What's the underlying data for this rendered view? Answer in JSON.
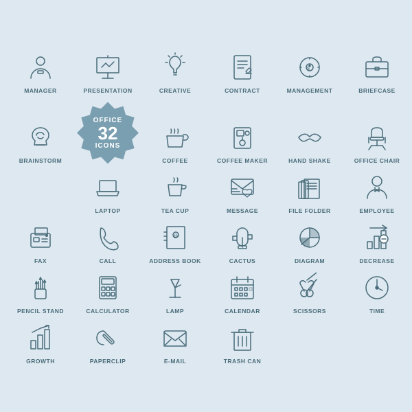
{
  "icons": [
    {
      "id": "manager",
      "label": "MANAGER"
    },
    {
      "id": "presentation",
      "label": "PRESENTATION"
    },
    {
      "id": "creative",
      "label": "CREATIVE"
    },
    {
      "id": "contract",
      "label": "CONTRACT"
    },
    {
      "id": "management",
      "label": "MANAGEMENT"
    },
    {
      "id": "briefcase",
      "label": "BRIEFCASE"
    },
    {
      "id": "brainstorm",
      "label": "BRAINSTORM"
    },
    {
      "id": "office-badge",
      "label": ""
    },
    {
      "id": "coffee",
      "label": "COFFEE"
    },
    {
      "id": "coffee-maker",
      "label": "COFFEE MAKER"
    },
    {
      "id": "handshake",
      "label": "HAND SHAKE"
    },
    {
      "id": "office-chair",
      "label": "OFFICE CHAIR"
    },
    {
      "id": "laptop",
      "label": "LAPTOP"
    },
    {
      "id": "tea-cup",
      "label": "TEA CUP"
    },
    {
      "id": "message",
      "label": "MESSAGE"
    },
    {
      "id": "file-folder",
      "label": "FILE FOLDER"
    },
    {
      "id": "employee",
      "label": "EMPLOYEE"
    },
    {
      "id": "fax",
      "label": "FAX"
    },
    {
      "id": "call",
      "label": "CALL"
    },
    {
      "id": "address-book",
      "label": "ADDRESS BOOK"
    },
    {
      "id": "cactus",
      "label": "CACTUS"
    },
    {
      "id": "diagram",
      "label": "DIAGRAM"
    },
    {
      "id": "decrease",
      "label": "DECREASE"
    },
    {
      "id": "pencil-stand",
      "label": "PENCIL STAND"
    },
    {
      "id": "calculator",
      "label": "CALCULATOR"
    },
    {
      "id": "lamp",
      "label": "LAMP"
    },
    {
      "id": "calendar",
      "label": "CALENDAR"
    },
    {
      "id": "scissors",
      "label": "SCISSORS"
    },
    {
      "id": "time",
      "label": "TIME"
    },
    {
      "id": "growth",
      "label": "GROWTH"
    },
    {
      "id": "paperclip",
      "label": "PAPERCLIP"
    },
    {
      "id": "email",
      "label": "E-MAIL"
    },
    {
      "id": "trash-can",
      "label": "TRASH CAN"
    }
  ]
}
